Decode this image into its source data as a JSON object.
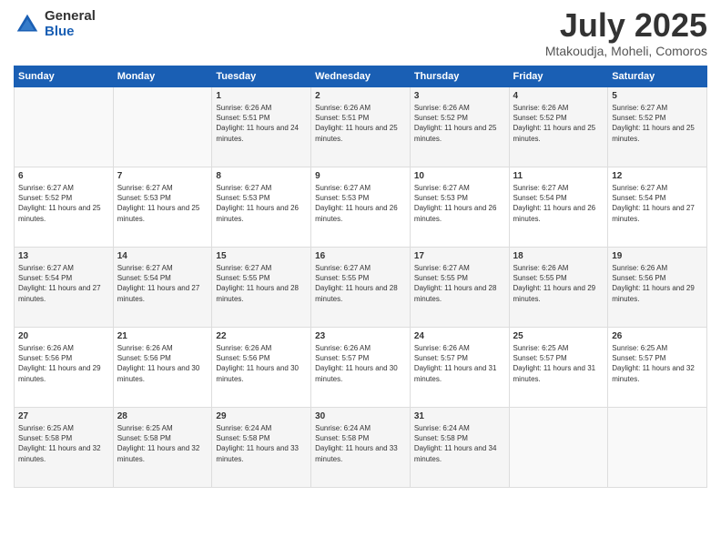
{
  "logo": {
    "general": "General",
    "blue": "Blue"
  },
  "title": {
    "month": "July 2025",
    "location": "Mtakoudja, Moheli, Comoros"
  },
  "weekdays": [
    "Sunday",
    "Monday",
    "Tuesday",
    "Wednesday",
    "Thursday",
    "Friday",
    "Saturday"
  ],
  "weeks": [
    [
      {
        "day": null,
        "sunrise": null,
        "sunset": null,
        "daylight": null
      },
      {
        "day": null,
        "sunrise": null,
        "sunset": null,
        "daylight": null
      },
      {
        "day": "1",
        "sunrise": "6:26 AM",
        "sunset": "5:51 PM",
        "daylight": "11 hours and 24 minutes."
      },
      {
        "day": "2",
        "sunrise": "6:26 AM",
        "sunset": "5:51 PM",
        "daylight": "11 hours and 25 minutes."
      },
      {
        "day": "3",
        "sunrise": "6:26 AM",
        "sunset": "5:52 PM",
        "daylight": "11 hours and 25 minutes."
      },
      {
        "day": "4",
        "sunrise": "6:26 AM",
        "sunset": "5:52 PM",
        "daylight": "11 hours and 25 minutes."
      },
      {
        "day": "5",
        "sunrise": "6:27 AM",
        "sunset": "5:52 PM",
        "daylight": "11 hours and 25 minutes."
      }
    ],
    [
      {
        "day": "6",
        "sunrise": "6:27 AM",
        "sunset": "5:52 PM",
        "daylight": "11 hours and 25 minutes."
      },
      {
        "day": "7",
        "sunrise": "6:27 AM",
        "sunset": "5:53 PM",
        "daylight": "11 hours and 25 minutes."
      },
      {
        "day": "8",
        "sunrise": "6:27 AM",
        "sunset": "5:53 PM",
        "daylight": "11 hours and 26 minutes."
      },
      {
        "day": "9",
        "sunrise": "6:27 AM",
        "sunset": "5:53 PM",
        "daylight": "11 hours and 26 minutes."
      },
      {
        "day": "10",
        "sunrise": "6:27 AM",
        "sunset": "5:53 PM",
        "daylight": "11 hours and 26 minutes."
      },
      {
        "day": "11",
        "sunrise": "6:27 AM",
        "sunset": "5:54 PM",
        "daylight": "11 hours and 26 minutes."
      },
      {
        "day": "12",
        "sunrise": "6:27 AM",
        "sunset": "5:54 PM",
        "daylight": "11 hours and 27 minutes."
      }
    ],
    [
      {
        "day": "13",
        "sunrise": "6:27 AM",
        "sunset": "5:54 PM",
        "daylight": "11 hours and 27 minutes."
      },
      {
        "day": "14",
        "sunrise": "6:27 AM",
        "sunset": "5:54 PM",
        "daylight": "11 hours and 27 minutes."
      },
      {
        "day": "15",
        "sunrise": "6:27 AM",
        "sunset": "5:55 PM",
        "daylight": "11 hours and 28 minutes."
      },
      {
        "day": "16",
        "sunrise": "6:27 AM",
        "sunset": "5:55 PM",
        "daylight": "11 hours and 28 minutes."
      },
      {
        "day": "17",
        "sunrise": "6:27 AM",
        "sunset": "5:55 PM",
        "daylight": "11 hours and 28 minutes."
      },
      {
        "day": "18",
        "sunrise": "6:26 AM",
        "sunset": "5:55 PM",
        "daylight": "11 hours and 29 minutes."
      },
      {
        "day": "19",
        "sunrise": "6:26 AM",
        "sunset": "5:56 PM",
        "daylight": "11 hours and 29 minutes."
      }
    ],
    [
      {
        "day": "20",
        "sunrise": "6:26 AM",
        "sunset": "5:56 PM",
        "daylight": "11 hours and 29 minutes."
      },
      {
        "day": "21",
        "sunrise": "6:26 AM",
        "sunset": "5:56 PM",
        "daylight": "11 hours and 30 minutes."
      },
      {
        "day": "22",
        "sunrise": "6:26 AM",
        "sunset": "5:56 PM",
        "daylight": "11 hours and 30 minutes."
      },
      {
        "day": "23",
        "sunrise": "6:26 AM",
        "sunset": "5:57 PM",
        "daylight": "11 hours and 30 minutes."
      },
      {
        "day": "24",
        "sunrise": "6:26 AM",
        "sunset": "5:57 PM",
        "daylight": "11 hours and 31 minutes."
      },
      {
        "day": "25",
        "sunrise": "6:25 AM",
        "sunset": "5:57 PM",
        "daylight": "11 hours and 31 minutes."
      },
      {
        "day": "26",
        "sunrise": "6:25 AM",
        "sunset": "5:57 PM",
        "daylight": "11 hours and 32 minutes."
      }
    ],
    [
      {
        "day": "27",
        "sunrise": "6:25 AM",
        "sunset": "5:58 PM",
        "daylight": "11 hours and 32 minutes."
      },
      {
        "day": "28",
        "sunrise": "6:25 AM",
        "sunset": "5:58 PM",
        "daylight": "11 hours and 32 minutes."
      },
      {
        "day": "29",
        "sunrise": "6:24 AM",
        "sunset": "5:58 PM",
        "daylight": "11 hours and 33 minutes."
      },
      {
        "day": "30",
        "sunrise": "6:24 AM",
        "sunset": "5:58 PM",
        "daylight": "11 hours and 33 minutes."
      },
      {
        "day": "31",
        "sunrise": "6:24 AM",
        "sunset": "5:58 PM",
        "daylight": "11 hours and 34 minutes."
      },
      {
        "day": null,
        "sunrise": null,
        "sunset": null,
        "daylight": null
      },
      {
        "day": null,
        "sunrise": null,
        "sunset": null,
        "daylight": null
      }
    ]
  ]
}
